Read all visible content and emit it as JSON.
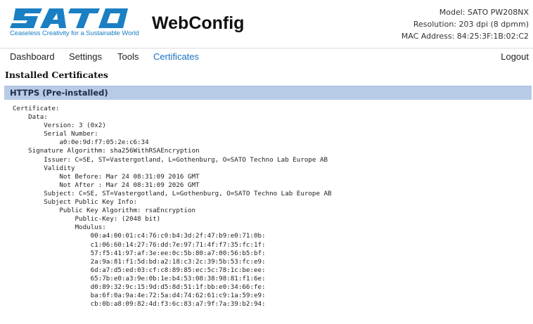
{
  "header": {
    "brand": "SATO",
    "tagline": "Ceaseless Creativity for a Sustainable World",
    "app_title": "WebConfig",
    "model": "Model: SATO PW208NX",
    "resolution": "Resolution: 203 dpi (8 dpmm)",
    "mac": "MAC Address: 84:25:3F:1B:02:C2"
  },
  "nav": {
    "items": [
      "Dashboard",
      "Settings",
      "Tools",
      "Certificates"
    ],
    "active": "Certificates",
    "logout": "Logout"
  },
  "main": {
    "heading": "Installed Certificates",
    "panel_title": "HTTPS (Pre-installed)",
    "certificate_lines": [
      "Certificate:",
      "    Data:",
      "        Version: 3 (0x2)",
      "        Serial Number:",
      "            a0:0e:9d:f7:05:2e:c6:34",
      "    Signature Algorithm: sha256WithRSAEncryption",
      "        Issuer: C=SE, ST=Vastergotland, L=Gothenburg, O=SATO Techno Lab Europe AB",
      "        Validity",
      "            Not Before: Mar 24 08:31:09 2016 GMT",
      "            Not After : Mar 24 08:31:09 2026 GMT",
      "        Subject: C=SE, ST=Vastergotland, L=Gothenburg, O=SATO Techno Lab Europe AB",
      "        Subject Public Key Info:",
      "            Public Key Algorithm: rsaEncryption",
      "                Public-Key: (2048 bit)",
      "                Modulus:",
      "                    00:a4:00:01:c4:76:c0:b4:3d:2f:47:b9:e0:71:0b:",
      "                    c1:06:60:14:27:76:dd:7e:97:71:4f:f7:35:fc:1f:",
      "                    57:f5:41:97:af:3e:ee:0c:5b:80:a7:00:56:b5:bf:",
      "                    2a:9a:81:f1:5d:bd:a2:18:c3:2c:39:5b:53:fc:e9:",
      "                    6d:a7:d5:ed:03:cf:c8:89:85:ec:5c:78:1c:be:ee:",
      "                    65:7b:e0:a3:9e:0b:1e:b4:53:08:38:98:81:f1:6e:",
      "                    d0:89:32:9c:15:9d:d5:8d:51:1f:bb:e0:34:66:fe:",
      "                    ba:6f:0a:9a:4e:72:5a:d4:74:62:61:c9:1a:59:e9:",
      "                    cb:0b:a8:09:82:4d:f3:6c:83:a7:9f:7a:39:b2:94:"
    ]
  },
  "colors": {
    "brand_blue": "#1b7fc4",
    "nav_active": "#1b73c2",
    "panel_bar": "#b7cbe6"
  }
}
